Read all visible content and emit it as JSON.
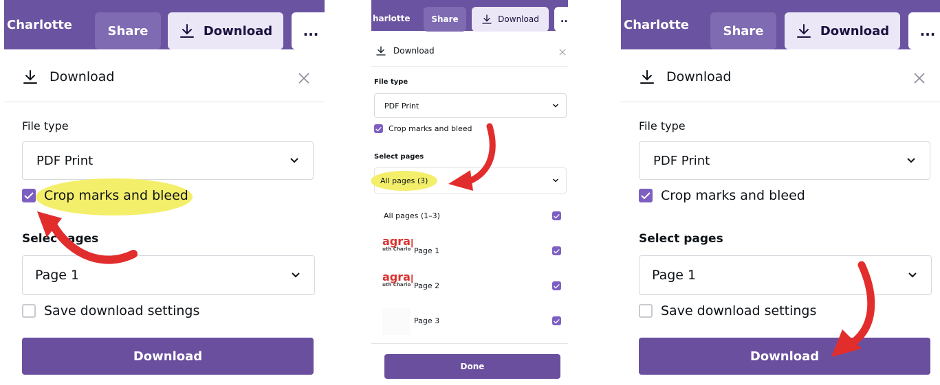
{
  "colors": {
    "topbar": "#6a53a1",
    "primary_button": "#6a4f9e",
    "checkbox": "#7d5fc2",
    "highlight": "#f4ef6a",
    "arrow": "#e22d2d"
  },
  "icons": [
    "download-icon",
    "close-icon",
    "chevron-down-icon",
    "check-icon",
    "more-icon"
  ],
  "topbar": {
    "name": "Charlotte",
    "name_small": "harlotte",
    "share": "Share",
    "download": "Download",
    "more": "..."
  },
  "panel1": {
    "header": "Download",
    "file_type_label": "File type",
    "file_type_value": "PDF Print",
    "crop_marks": "Crop marks and bleed",
    "select_pages_label_a": "Selec",
    "select_pages_label_b": "ages",
    "pages_value": "Page 1",
    "save_settings": "Save download settings",
    "download_button": "Download"
  },
  "panel2": {
    "header": "Download",
    "file_type_label": "File type",
    "file_type_value": "PDF Print",
    "crop_marks": "Crop marks and bleed",
    "select_pages_label": "Select pages",
    "pages_value": "All pages (3)",
    "pages": [
      {
        "label": "All pages (1–3)",
        "checked": true
      },
      {
        "label": "Page 1",
        "checked": true
      },
      {
        "label": "Page 2",
        "checked": true
      },
      {
        "label": "Page 3",
        "checked": true
      }
    ],
    "thumb_logo": "agrapl",
    "thumb_sub": "uth Charlo",
    "done_button": "Done"
  },
  "panel3": {
    "header": "Download",
    "file_type_label": "File type",
    "file_type_value": "PDF Print",
    "crop_marks": "Crop marks and bleed",
    "select_pages_label": "Select pages",
    "pages_value": "Page 1",
    "save_settings": "Save download settings",
    "download_button": "Download"
  }
}
